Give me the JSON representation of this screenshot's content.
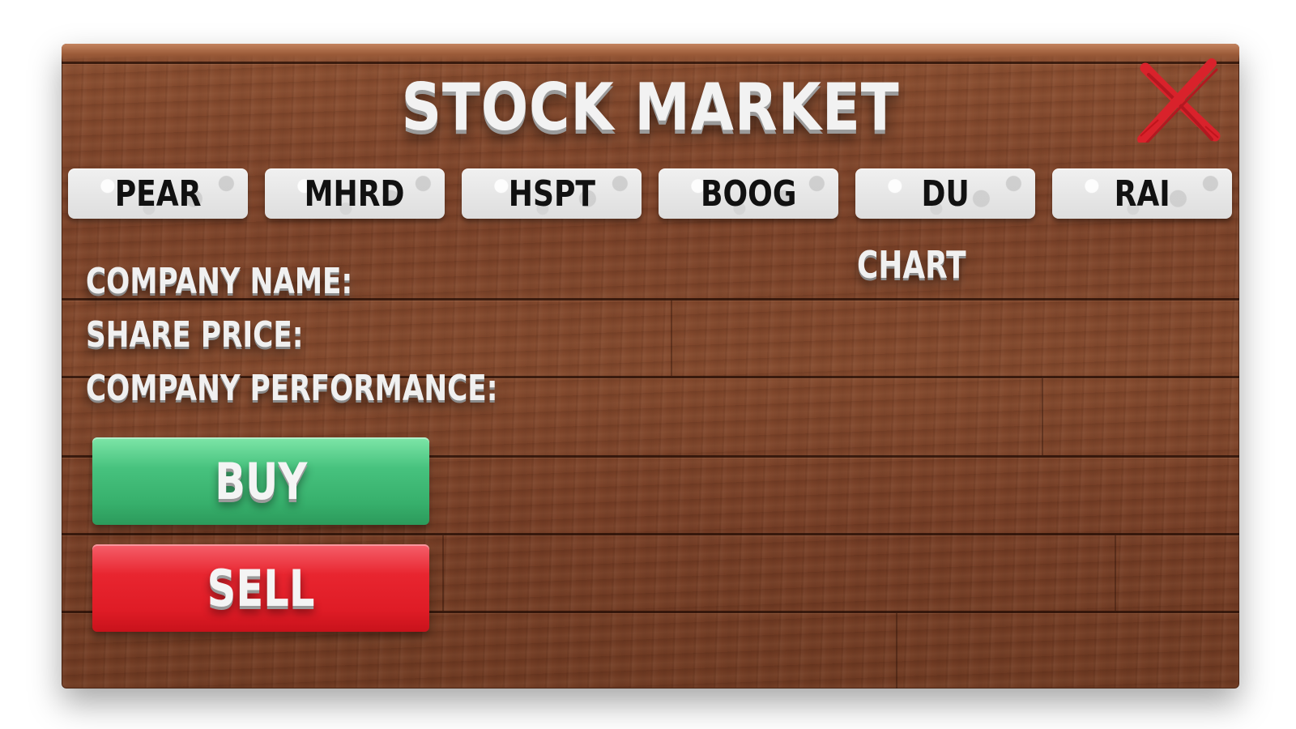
{
  "window": {
    "title": "STOCK MARKET",
    "close_icon": "close-x-icon"
  },
  "tabs": [
    {
      "label": "PEAR"
    },
    {
      "label": "MHRD"
    },
    {
      "label": "HSPT"
    },
    {
      "label": "BOOG"
    },
    {
      "label": "DU"
    },
    {
      "label": "RAI"
    }
  ],
  "details": {
    "company_name_label": "COMPANY NAME:",
    "share_price_label": "SHARE PRICE:",
    "company_performance_label": "COMPANY PERFORMANCE:"
  },
  "chart": {
    "label": "CHART"
  },
  "actions": {
    "buy_label": "BUY",
    "sell_label": "SELL"
  },
  "colors": {
    "wood": "#7a4128",
    "buy": "#3fb873",
    "sell": "#e41e28",
    "close": "#d9222b",
    "text": "#f0f0f0"
  }
}
